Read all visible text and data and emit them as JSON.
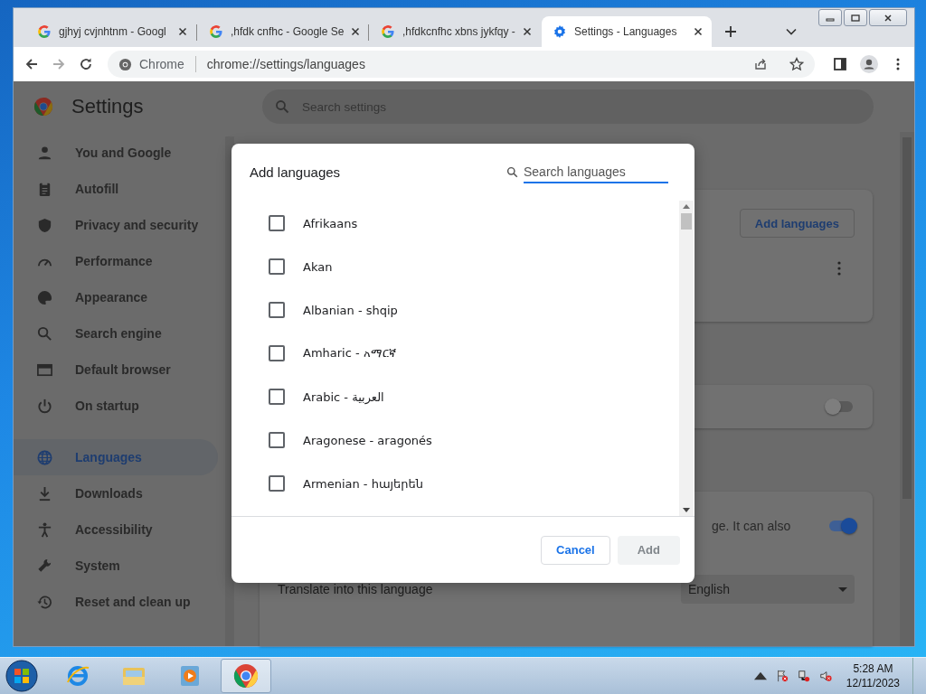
{
  "tabs": [
    {
      "title": "gjhyj cvjnhtnm - Googl",
      "selected": false
    },
    {
      "title": ",hfdk cnfhc - Google Se",
      "selected": false
    },
    {
      "title": ",hfdkcnfhc xbns jykfqy -",
      "selected": false
    },
    {
      "title": "Settings - Languages",
      "selected": true
    }
  ],
  "address_bar": {
    "site_label": "Chrome",
    "url": "chrome://settings/languages"
  },
  "settings": {
    "title": "Settings",
    "search_placeholder": "Search settings",
    "nav": [
      {
        "label": "You and Google",
        "selected": false
      },
      {
        "label": "Autofill",
        "selected": false
      },
      {
        "label": "Privacy and security",
        "selected": false
      },
      {
        "label": "Performance",
        "selected": false
      },
      {
        "label": "Appearance",
        "selected": false
      },
      {
        "label": "Search engine",
        "selected": false
      },
      {
        "label": "Default browser",
        "selected": false
      },
      {
        "label": "On startup",
        "selected": false
      },
      {
        "label": "Languages",
        "selected": true
      },
      {
        "label": "Downloads",
        "selected": false
      },
      {
        "label": "Accessibility",
        "selected": false
      },
      {
        "label": "System",
        "selected": false
      },
      {
        "label": "Reset and clean up",
        "selected": false
      }
    ]
  },
  "page": {
    "add_languages_button": "Add languages",
    "toggles": [
      {
        "on": false
      },
      {
        "on": true
      }
    ],
    "partial_text": "ge. It can also",
    "translate_label": "Translate into this language",
    "translate_value": "English"
  },
  "dialog": {
    "title": "Add languages",
    "search_placeholder": "Search languages",
    "languages": [
      {
        "name": "Afrikaans",
        "checked": false
      },
      {
        "name": "Akan",
        "checked": false
      },
      {
        "name": "Albanian - shqip",
        "checked": false
      },
      {
        "name": "Amharic - አማርኛ",
        "checked": false
      },
      {
        "name": "Arabic - العربية",
        "checked": false
      },
      {
        "name": "Aragonese - aragonés",
        "checked": false
      },
      {
        "name": "Armenian - հայերեն",
        "checked": false
      }
    ],
    "cancel_button": "Cancel",
    "add_button": {
      "label": "Add",
      "disabled": true
    }
  },
  "taskbar": {
    "apps": [
      {
        "kind": "ie",
        "active": false
      },
      {
        "kind": "explorer",
        "active": false
      },
      {
        "kind": "media",
        "active": false
      },
      {
        "kind": "chrome",
        "active": true
      }
    ],
    "time": "5:28 AM",
    "date": "12/11/2023"
  }
}
